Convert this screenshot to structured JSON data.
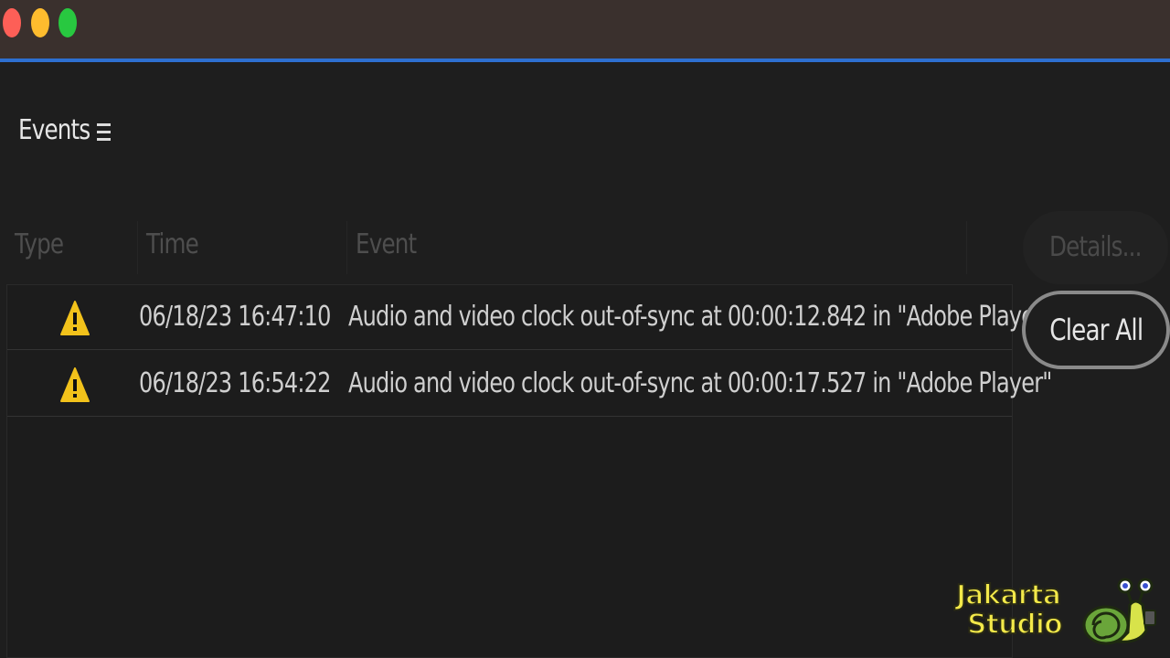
{
  "window": {
    "traffic_lights": {
      "close_color": "#fd5f57",
      "minimize_color": "#febc2e",
      "maximize_color": "#28c840"
    },
    "accent_color": "#2d6fd0"
  },
  "panel": {
    "title": "Events",
    "menu_icon": "hamburger-menu-icon"
  },
  "table": {
    "columns": [
      "Type",
      "Time",
      "Event"
    ],
    "rows": [
      {
        "type_icon": "warning-icon",
        "time": "06/18/23 16:47:10",
        "event": "Audio and video clock out-of-sync at 00:00:12.842 in \"Adobe Player\""
      },
      {
        "type_icon": "warning-icon",
        "time": "06/18/23 16:54:22",
        "event": "Audio and video clock out-of-sync at 00:00:17.527 in \"Adobe Player\""
      }
    ]
  },
  "buttons": {
    "details_label": "Details...",
    "clear_all_label": "Clear All"
  },
  "watermark": {
    "line1": "Jakarta",
    "line2": "Studio",
    "color": "#f3e94a"
  }
}
